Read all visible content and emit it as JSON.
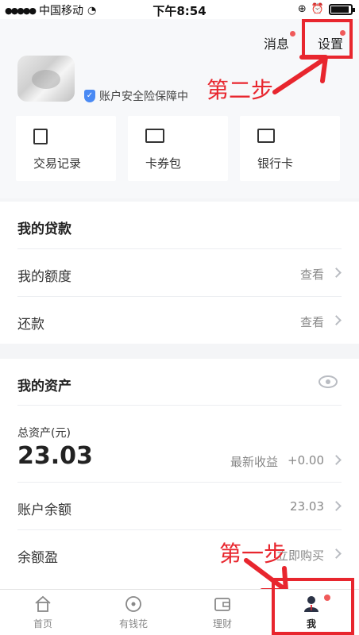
{
  "status": {
    "carrier": "中国移动",
    "time": "下午8:54"
  },
  "header": {
    "messages_label": "消息",
    "settings_label": "设置",
    "security_text": "账户安全险保障中"
  },
  "quick_cards": [
    {
      "label": "交易记录",
      "icon": "receipt-icon"
    },
    {
      "label": "卡券包",
      "icon": "coupon-icon"
    },
    {
      "label": "银行卡",
      "icon": "bank-card-icon"
    }
  ],
  "annotations": {
    "step_two": "第二步",
    "step_one": "第一步"
  },
  "loans": {
    "title": "我的贷款",
    "rows": [
      {
        "name": "我的额度",
        "value": "查看"
      },
      {
        "name": "还款",
        "value": "查看"
      }
    ]
  },
  "assets": {
    "title": "我的资产",
    "total_label": "总资产(元)",
    "total_value": "23.03",
    "latest_income_label": "最新收益",
    "latest_income_value": "+0.00",
    "rows": [
      {
        "name": "账户余额",
        "value": "23.03"
      },
      {
        "name": "余额盈",
        "value": "立即购买"
      }
    ]
  },
  "tabbar": [
    {
      "label": "首页",
      "icon": "home-icon"
    },
    {
      "label": "有钱花",
      "icon": "coin-icon"
    },
    {
      "label": "理财",
      "icon": "wallet-icon"
    },
    {
      "label": "我",
      "icon": "profile-icon"
    }
  ]
}
